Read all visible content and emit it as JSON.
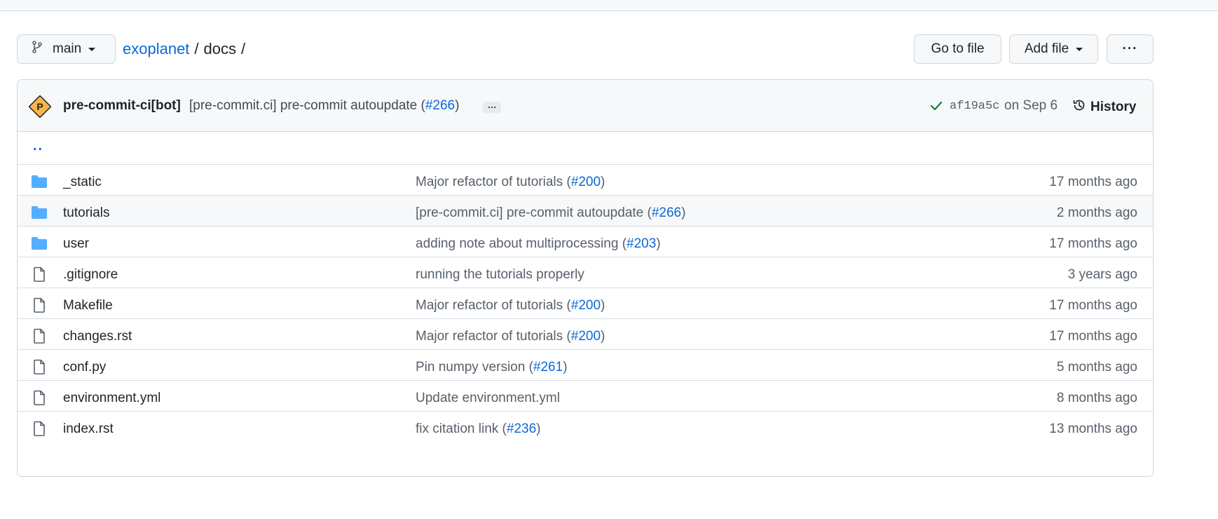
{
  "branch": {
    "name": "main"
  },
  "breadcrumb": {
    "repo": "exoplanet",
    "sep1": "/",
    "folder": "docs",
    "sep2": "/"
  },
  "toolbar": {
    "goto_label": "Go to file",
    "addfile_label": "Add file",
    "more_label": "···"
  },
  "commit": {
    "author": "pre-commit-ci[bot]",
    "message_prefix": "[pre-commit.ci] pre-commit autoupdate (",
    "pr": "#266",
    "message_suffix": ")",
    "ellipsis": "…",
    "sha": "af19a5c",
    "date": "on Sep 6",
    "history_label": "History",
    "avatar_letter": "P"
  },
  "parent_dir": "..",
  "files": [
    {
      "type": "folder",
      "name": "_static",
      "msg_prefix": "Major refactor of tutorials (",
      "pr": "#200",
      "msg_suffix": ")",
      "age": "17 months ago"
    },
    {
      "type": "folder",
      "name": "tutorials",
      "msg_prefix": "[pre-commit.ci] pre-commit autoupdate (",
      "pr": "#266",
      "msg_suffix": ")",
      "age": "2 months ago"
    },
    {
      "type": "folder",
      "name": "user",
      "msg_prefix": "adding note about multiprocessing (",
      "pr": "#203",
      "msg_suffix": ")",
      "age": "17 months ago"
    },
    {
      "type": "file",
      "name": ".gitignore",
      "msg_prefix": "running the tutorials properly",
      "pr": "",
      "msg_suffix": "",
      "age": "3 years ago"
    },
    {
      "type": "file",
      "name": "Makefile",
      "msg_prefix": "Major refactor of tutorials (",
      "pr": "#200",
      "msg_suffix": ")",
      "age": "17 months ago"
    },
    {
      "type": "file",
      "name": "changes.rst",
      "msg_prefix": "Major refactor of tutorials (",
      "pr": "#200",
      "msg_suffix": ")",
      "age": "17 months ago"
    },
    {
      "type": "file",
      "name": "conf.py",
      "msg_prefix": "Pin numpy version (",
      "pr": "#261",
      "msg_suffix": ")",
      "age": "5 months ago"
    },
    {
      "type": "file",
      "name": "environment.yml",
      "msg_prefix": "Update environment.yml",
      "pr": "",
      "msg_suffix": "",
      "age": "8 months ago"
    },
    {
      "type": "file",
      "name": "index.rst",
      "msg_prefix": "fix citation link (",
      "pr": "#236",
      "msg_suffix": ")",
      "age": "13 months ago"
    }
  ],
  "colors": {
    "link": "#0969da",
    "folder": "#54aeff",
    "check": "#1a7f37",
    "avatar": "#f7b64a"
  }
}
